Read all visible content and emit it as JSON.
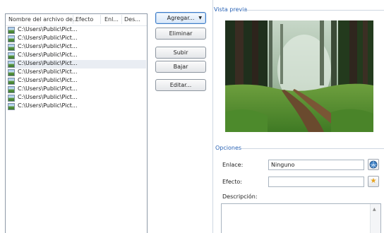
{
  "file_list": {
    "columns": [
      "Nombre del archivo de...",
      "Efecto",
      "Enl...",
      "Des..."
    ],
    "rows": [
      "C:\\Users\\Public\\Pict...",
      "C:\\Users\\Public\\Pict...",
      "C:\\Users\\Public\\Pict...",
      "C:\\Users\\Public\\Pict...",
      "C:\\Users\\Public\\Pict...",
      "C:\\Users\\Public\\Pict...",
      "C:\\Users\\Public\\Pict...",
      "C:\\Users\\Public\\Pict...",
      "C:\\Users\\Public\\Pict...",
      "C:\\Users\\Public\\Pict..."
    ]
  },
  "buttons": {
    "add": "Agregar...",
    "remove": "Eliminar",
    "up": "Subir",
    "down": "Bajar",
    "edit": "Editar..."
  },
  "preview": {
    "title": "Vista previa"
  },
  "options": {
    "title": "Opciones",
    "link_label": "Enlace:",
    "link_value": "Ninguno",
    "effect_label": "Efecto:",
    "effect_value": "",
    "description_label": "Descripción:",
    "description_value": ""
  },
  "colors": {
    "group_title": "#2a63b5",
    "accent": "#3d7bc6"
  }
}
